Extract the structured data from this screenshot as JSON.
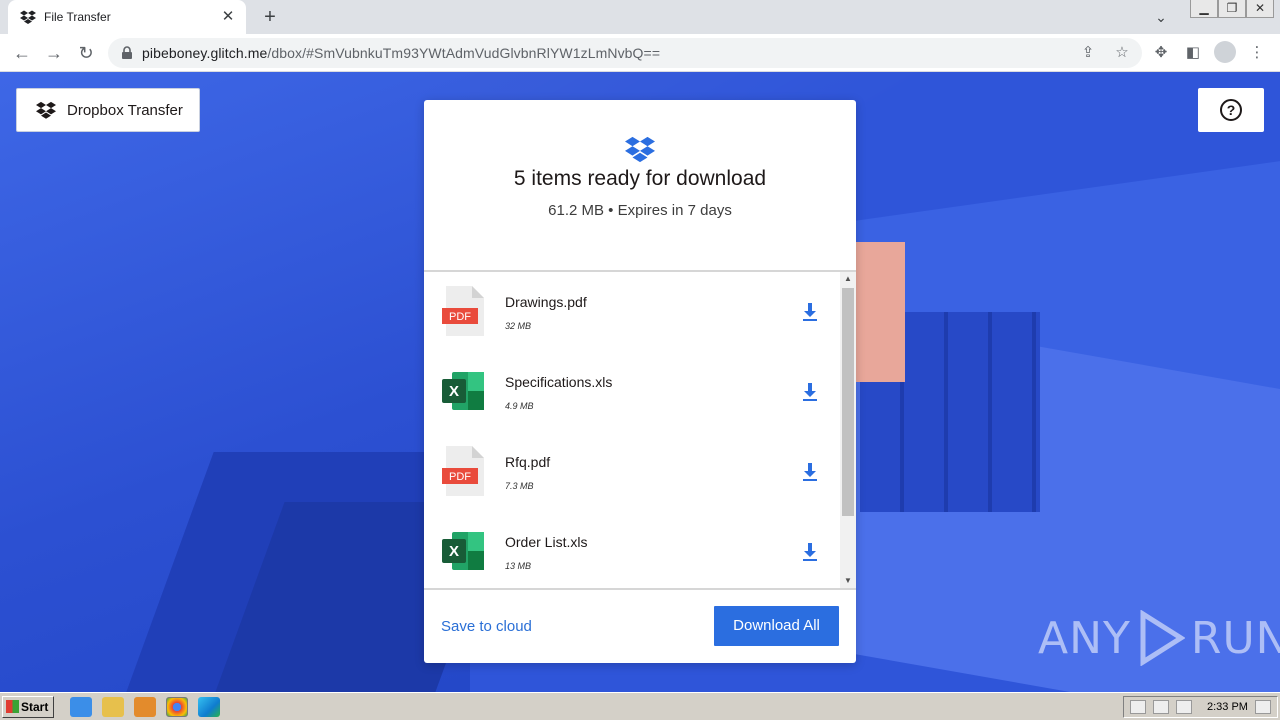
{
  "browser": {
    "tab_title": "File Transfer",
    "url_host": "pibeboney.glitch.me",
    "url_path": "/dbox/#SmVubnkuTm93YWtAdmVudGlvbnRlYW1zLmNvbQ=="
  },
  "page": {
    "brand_label": "Dropbox Transfer",
    "help_label": "?",
    "card": {
      "title": "5 items ready for download",
      "subtitle": "61.2 MB • Expires in 7 days",
      "files": [
        {
          "name": "Drawings.pdf",
          "size": "32 MB",
          "type": "pdf",
          "badge": "PDF"
        },
        {
          "name": "Specifications.xls",
          "size": "4.9 MB",
          "type": "xls",
          "badge": "X"
        },
        {
          "name": "Rfq.pdf",
          "size": "7.3 MB",
          "type": "pdf",
          "badge": "PDF"
        },
        {
          "name": "Order List.xls",
          "size": "13 MB",
          "type": "xls",
          "badge": "X"
        }
      ],
      "save_cloud_label": "Save to cloud",
      "download_all_label": "Download All"
    }
  },
  "watermark": {
    "left": "ANY",
    "right": "RUN"
  },
  "taskbar": {
    "start_label": "Start",
    "clock": "2:33 PM"
  },
  "colors": {
    "accent": "#2b6ee0",
    "background": "#2f55d9",
    "pdf_red": "#e94b3c",
    "excel_green": "#1d6f42"
  }
}
